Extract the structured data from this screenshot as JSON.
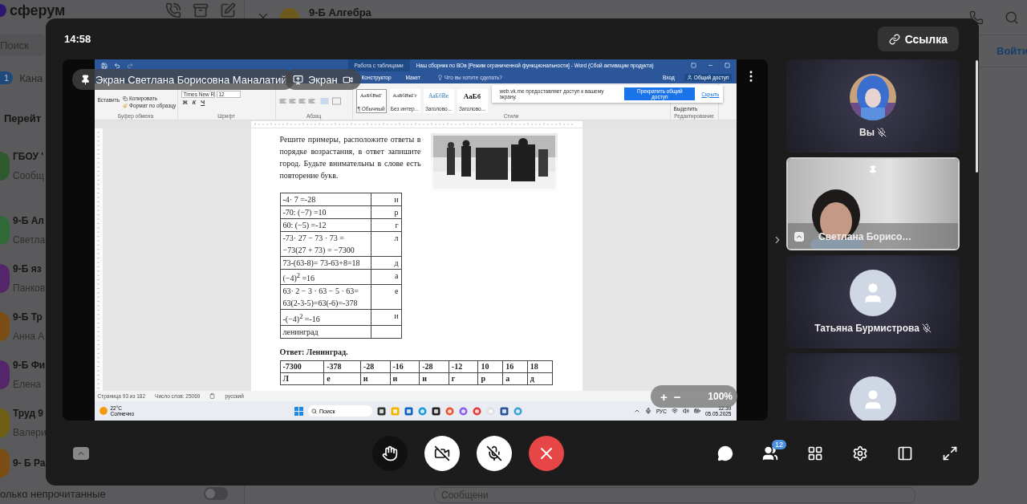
{
  "background": {
    "logo": "сферум",
    "search": {
      "placeholder": "Поиск"
    },
    "channels": {
      "badge": "1",
      "label": "Кана"
    },
    "goto": "Перейт",
    "chats": [
      {
        "title": "ГБОУ '",
        "preview": "Сообщ",
        "color": "#2e5a2e"
      },
      {
        "title": "9-Б Ал",
        "preview": "Светла",
        "color": "#2f6a36"
      },
      {
        "title": "9-Б яз",
        "preview": "Панков",
        "color": "#55256b"
      },
      {
        "title": "9-Б Тр",
        "preview": "Анна А",
        "color": "#7a4d14"
      },
      {
        "title": "9-Б Фи",
        "preview": "Елена",
        "color": "#55256b"
      },
      {
        "title": "Труд 9",
        "preview": "Валери",
        "color": "#6e5f14"
      },
      {
        "title": "9- Б Ра",
        "color": "#7a4d14"
      }
    ],
    "filter": {
      "label": "олько непрочитанные",
      "on": false
    },
    "chat": {
      "title": "9-Б Алгебра",
      "join": "Войти",
      "message": {
        "placeholder": "Сообщени"
      }
    }
  },
  "call": {
    "timer": "14:58",
    "link_button": "Ссылка",
    "stage": {
      "presenter": "Экран Светлана Борисовна Маналатий",
      "screen_button": "Экран",
      "zoom": {
        "plus": "+",
        "minus": "−",
        "value": "100%"
      },
      "word": {
        "context_tab": "Работа с таблицами",
        "title": "Наш сборник по ВОв [Режим ограниченной функциональности] - Word (Сбой активации продукта)",
        "tabs": [
          {
            "label": "Конструктор",
            "selected": false
          },
          {
            "label": "Макет",
            "selected": false
          }
        ],
        "tell_me": "Что вы хотите сделать?",
        "sign_in": "Вход",
        "share": "Общий доступ",
        "clipboard": {
          "paste": "Вставить",
          "copy": "Копировать",
          "format_painter": "Формат по образцу",
          "label": "Буфер обмена"
        },
        "font": {
          "name": "Times New R",
          "size": "12",
          "bold": "Ж",
          "italic": "К",
          "underline": "Ч",
          "label": "Шрифт"
        },
        "paragraph": {
          "label": "Абзац"
        },
        "styles": {
          "items": [
            {
              "sample": "АаБбВвГ",
              "name": "¶ Обычный",
              "selected": true
            },
            {
              "sample": "АаБбВвГг",
              "name": "Без интер...",
              "selected": false
            },
            {
              "sample": "АаБбВе",
              "name": "Заголово...",
              "selected": false
            },
            {
              "sample": "АаБб",
              "name": "Заголово...",
              "selected": false
            }
          ],
          "label": "Стили"
        },
        "editing": {
          "select": "Выделить",
          "label": "Редактирование"
        },
        "share_banner": {
          "text": "web.vk.me предоставляет доступ к вашему экрану.",
          "stop": "Прекратить общий доступ",
          "hide": "Скрыть"
        },
        "document": {
          "intro": "Решите примеры, расположите ответы в порядке возрастания, в ответ запишите город. Будьте внимательны в слове есть повторение букв.",
          "rows": [
            {
              "lines": [
                "-4· 7 =-28"
              ],
              "letter": "и"
            },
            {
              "lines": [
                "-70: (−7) =10"
              ],
              "letter": "р"
            },
            {
              "lines": [
                "60: (−5) =-12"
              ],
              "letter": "г"
            },
            {
              "lines": [
                "-73· 27 − 73 · 73 =",
                "−73(27 + 73) = −7300"
              ],
              "letter": "л"
            },
            {
              "lines": [
                "73-(63-8)= 73-63+8=18"
              ],
              "letter": "д"
            },
            {
              "lines": [
                "(−4)$^{2}$ =16"
              ],
              "letter": "а"
            },
            {
              "lines": [
                "63· 2 − 3 · 63 − 5 · 63=",
                "63(2-3-5)=63(-6)=-378"
              ],
              "letter": "е"
            },
            {
              "lines": [
                "-(−4)$^{2}$ =-16"
              ],
              "letter": "и"
            },
            {
              "lines": [
                "ленинград"
              ]
            }
          ],
          "answer": "Ответ: Ленинград.",
          "answer_table": [
            [
              "-7300",
              "-378",
              "-28",
              "-16",
              "-28",
              "-12",
              "10",
              "16",
              "18"
            ],
            [
              "Л",
              "е",
              "и",
              "и",
              "и",
              "г",
              "р",
              "а",
              "д"
            ]
          ]
        },
        "status": {
          "page": "Страница 93 из 182",
          "words": "Число слов: 25069",
          "language": "русский"
        },
        "taskbar": {
          "temperature": "22°C",
          "weather": "Солнечно",
          "search": "Поиск",
          "language": "РУС",
          "time": "12:39",
          "date": "05.05.2025"
        }
      }
    },
    "participants": [
      {
        "kind": "avatar",
        "name": "Вы",
        "muted": true,
        "pinned": false,
        "sharing": false,
        "selected": false
      },
      {
        "kind": "video",
        "name": "Светлана Борисо…",
        "muted": false,
        "pinned": true,
        "sharing": true,
        "selected": true
      },
      {
        "kind": "placeholder",
        "name": "Татьяна Бурмистрова",
        "muted": true,
        "pinned": false,
        "sharing": false,
        "selected": false
      },
      {
        "kind": "placeholder",
        "muted": false,
        "pinned": false,
        "sharing": false,
        "selected": false
      }
    ],
    "controls": {
      "center": [
        {
          "kind": "hand",
          "on": false
        },
        {
          "kind": "camera",
          "on": false
        },
        {
          "kind": "mic",
          "on": false
        },
        {
          "kind": "end"
        }
      ],
      "right": [
        {
          "kind": "chat"
        },
        {
          "kind": "people",
          "badge": "12"
        },
        {
          "kind": "grid"
        },
        {
          "kind": "settings"
        },
        {
          "kind": "layout"
        },
        {
          "kind": "fullscreen"
        }
      ]
    }
  }
}
